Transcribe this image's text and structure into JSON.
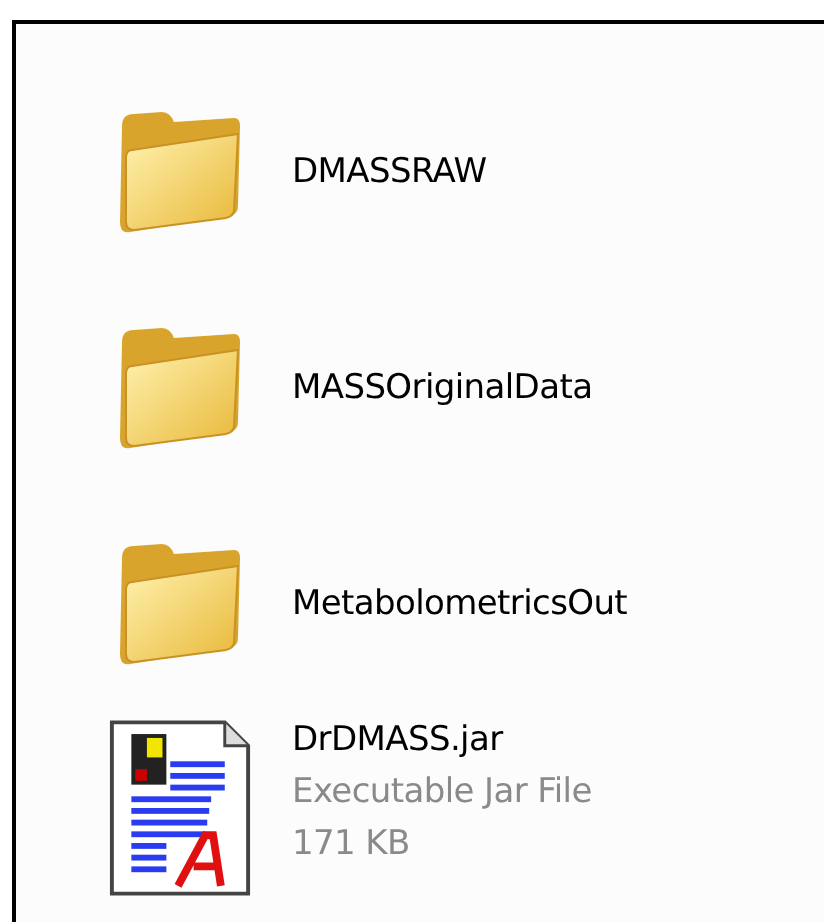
{
  "items": [
    {
      "kind": "folder",
      "name": "DMASSRAW"
    },
    {
      "kind": "folder",
      "name": "MASSOriginalData"
    },
    {
      "kind": "folder",
      "name": "MetabolometricsOut"
    },
    {
      "kind": "file",
      "name": "DrDMASS.jar",
      "details": [
        "Executable Jar File",
        "171 KB"
      ]
    }
  ]
}
